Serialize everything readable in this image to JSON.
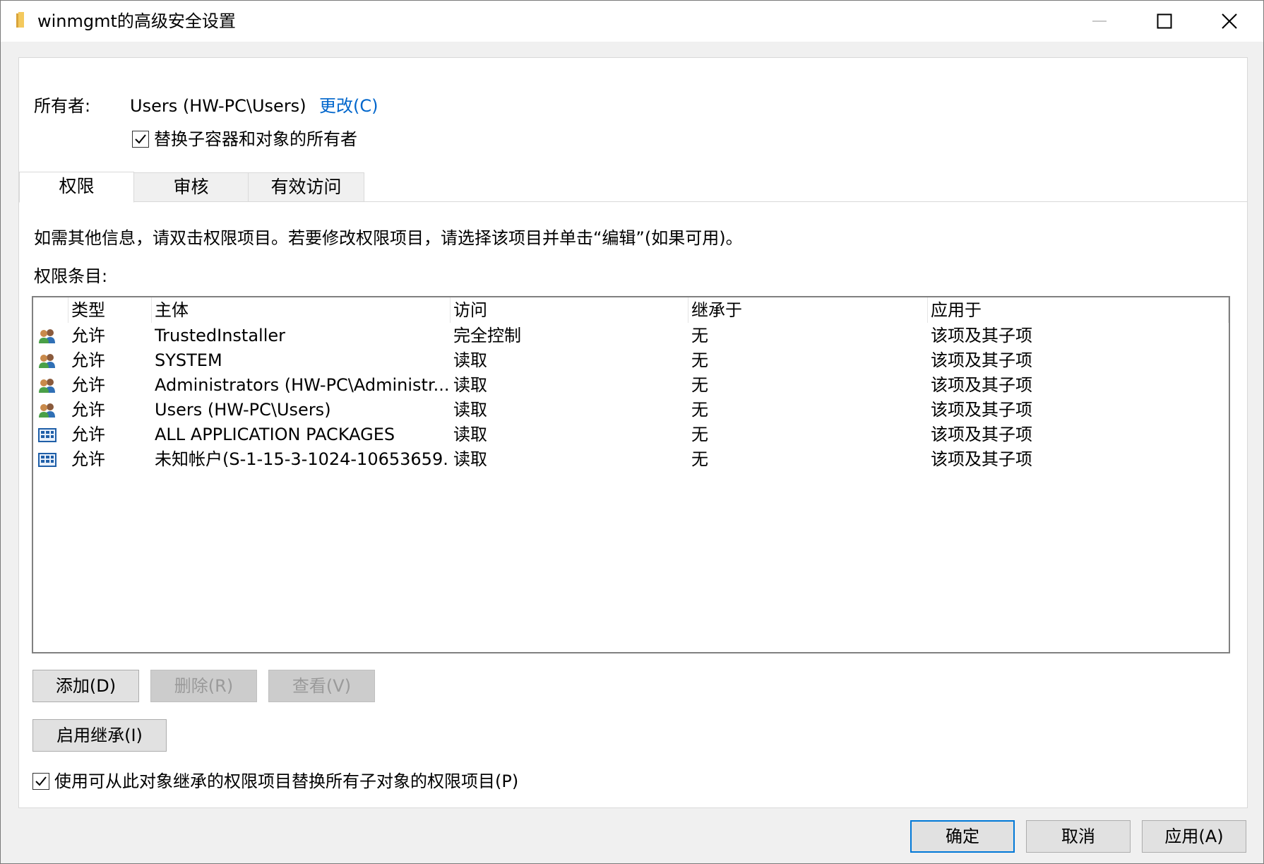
{
  "window": {
    "title": "winmgmt的高级安全设置"
  },
  "owner": {
    "label": "所有者:",
    "value": "Users (HW-PC\\Users)",
    "change_link": "更改(C)",
    "replace_checkbox_label": "替换子容器和对象的所有者",
    "replace_checked": true
  },
  "tabs": [
    {
      "label": "权限",
      "active": true
    },
    {
      "label": "审核",
      "active": false
    },
    {
      "label": "有效访问",
      "active": false
    }
  ],
  "info_text": "如需其他信息，请双击权限项目。若要修改权限项目，请选择该项目并单击“编辑”(如果可用)。",
  "entries_label": "权限条目:",
  "table": {
    "columns": [
      "类型",
      "主体",
      "访问",
      "继承于",
      "应用于"
    ],
    "rows": [
      {
        "icon": "user-group-icon",
        "type": "允许",
        "principal": "TrustedInstaller",
        "access": "完全控制",
        "inherited": "无",
        "applies": "该项及其子项"
      },
      {
        "icon": "user-group-icon",
        "type": "允许",
        "principal": "SYSTEM",
        "access": "读取",
        "inherited": "无",
        "applies": "该项及其子项"
      },
      {
        "icon": "user-group-icon",
        "type": "允许",
        "principal": "Administrators (HW-PC\\Administr...",
        "access": "读取",
        "inherited": "无",
        "applies": "该项及其子项"
      },
      {
        "icon": "user-group-icon",
        "type": "允许",
        "principal": "Users (HW-PC\\Users)",
        "access": "读取",
        "inherited": "无",
        "applies": "该项及其子项"
      },
      {
        "icon": "app-packages-icon",
        "type": "允许",
        "principal": "ALL APPLICATION PACKAGES",
        "access": "读取",
        "inherited": "无",
        "applies": "该项及其子项"
      },
      {
        "icon": "app-packages-icon",
        "type": "允许",
        "principal": "未知帐户(S-1-15-3-1024-10653659...",
        "access": "读取",
        "inherited": "无",
        "applies": "该项及其子项"
      }
    ]
  },
  "buttons": {
    "add": "添加(D)",
    "remove": "删除(R)",
    "view": "查看(V)",
    "enable_inheritance": "启用继承(I)",
    "ok": "确定",
    "cancel": "取消",
    "apply": "应用(A)"
  },
  "replace_child": {
    "label": "使用可从此对象继承的权限项目替换所有子对象的权限项目(P)",
    "checked": true
  },
  "colors": {
    "link": "#0066cc",
    "default_button_border": "#0078d7",
    "window_bg": "#f0f0f0"
  }
}
